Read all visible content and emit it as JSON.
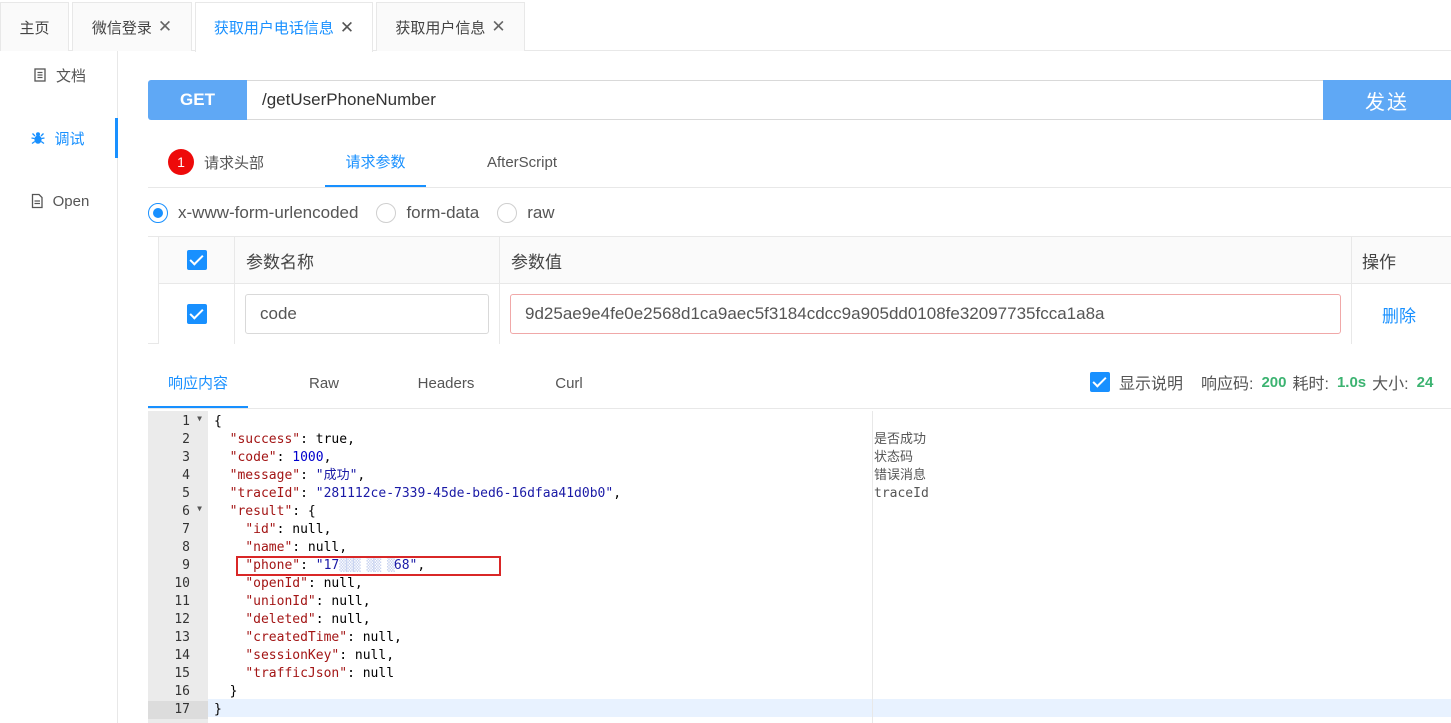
{
  "tabs": [
    {
      "label": "主页",
      "closable": false
    },
    {
      "label": "微信登录",
      "closable": true
    },
    {
      "label": "获取用户电话信息",
      "closable": true,
      "active": true
    },
    {
      "label": "获取用户信息",
      "closable": true
    }
  ],
  "close_glyph": "✕",
  "sidenav": [
    {
      "label": "文档",
      "icon": "document-icon"
    },
    {
      "label": "调试",
      "icon": "bug-icon",
      "active": true
    },
    {
      "label": "Open",
      "icon": "file-icon"
    }
  ],
  "request": {
    "method": "GET",
    "url": "/getUserPhoneNumber",
    "send_label": "发送"
  },
  "request_tabs": {
    "headers_badge": "1",
    "headers": "请求头部",
    "params": "请求参数",
    "afterscript": "AfterScript"
  },
  "body_types": [
    "x-www-form-urlencoded",
    "form-data",
    "raw"
  ],
  "params_table": {
    "col_name": "参数名称",
    "col_value": "参数值",
    "col_action": "操作",
    "rows": [
      {
        "name": "code",
        "value": "9d25ae9e4fe0e2568d1ca9aec5f3184cdcc9a905dd0108fe32097735fcca1a8a",
        "action": "删除"
      }
    ]
  },
  "response_tabs": [
    "响应内容",
    "Raw",
    "Headers",
    "Curl"
  ],
  "response_info": {
    "show_desc": "显示说明",
    "code_label": "响应码:",
    "code": "200",
    "time_label": "耗时:",
    "time": "1.0s",
    "size_label": "大小:",
    "size": "24"
  },
  "code_lines": {
    "l1": "{",
    "l2_key": "\"success\"",
    "l2_rest": ": true,",
    "l3_key": "\"code\"",
    "l3_colon": ": ",
    "l3_val": "1000",
    "l3_end": ",",
    "l4_key": "\"message\"",
    "l4_colon": ": ",
    "l4_val": "\"成功\"",
    "l4_end": ",",
    "l5_key": "\"traceId\"",
    "l5_colon": ": ",
    "l5_val": "\"281112ce-7339-45de-bed6-16dfaa41d0b0\"",
    "l5_end": ",",
    "l6_key": "\"result\"",
    "l6_rest": ": {",
    "l7_key": "\"id\"",
    "l7_rest": ": null,",
    "l8_key": "\"name\"",
    "l8_rest": ": null,",
    "l9_key": "\"phone\"",
    "l9_colon": ": ",
    "l9_val_a": "\"17",
    "l9_val_b": "68\"",
    "l9_end": ",",
    "l10_key": "\"openId\"",
    "l10_rest": ": null,",
    "l11_key": "\"unionId\"",
    "l11_rest": ": null,",
    "l12_key": "\"deleted\"",
    "l12_rest": ": null,",
    "l13_key": "\"createdTime\"",
    "l13_rest": ": null,",
    "l14_key": "\"sessionKey\"",
    "l14_rest": ": null,",
    "l15_key": "\"trafficJson\"",
    "l15_rest": ": null",
    "l16": "}",
    "l17": "}"
  },
  "line_numbers": [
    "1",
    "2",
    "3",
    "4",
    "5",
    "6",
    "7",
    "8",
    "9",
    "10",
    "11",
    "12",
    "13",
    "14",
    "15",
    "16",
    "17"
  ],
  "notes": {
    "success": "是否成功",
    "code": "状态码",
    "message": "错误消息",
    "traceId": "traceId"
  }
}
